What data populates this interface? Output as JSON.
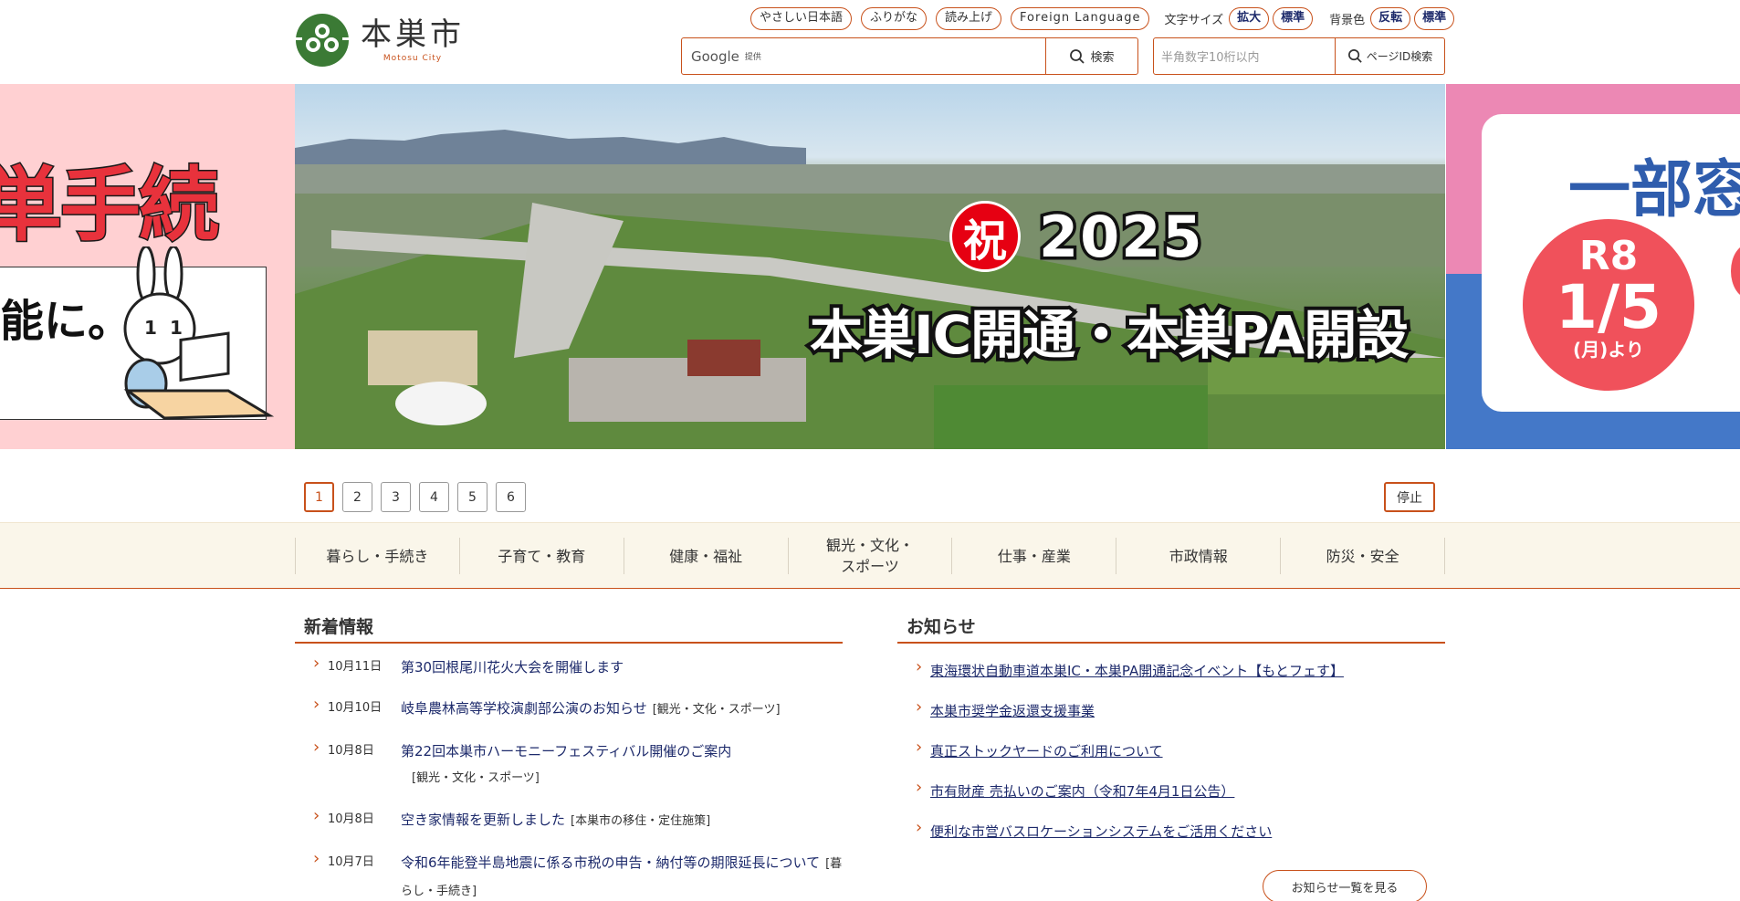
{
  "site": {
    "name": "本巣市",
    "name_romaji": "Motosu City"
  },
  "utility": {
    "easy_japanese": "やさしい日本語",
    "furigana": "ふりがな",
    "read_aloud": "読み上げ",
    "foreign_language": "Foreign Language",
    "font_size_label": "文字サイズ",
    "font_size_enlarge": "拡大",
    "font_size_standard": "標準",
    "bg_color_label": "背景色",
    "bg_invert": "反転",
    "bg_standard": "標準"
  },
  "search": {
    "provider": "Google",
    "provided_by": "提供",
    "button_label": "検索"
  },
  "page_id_search": {
    "placeholder": "半角数字10桁以内",
    "button_label": "ページID検索"
  },
  "carousel": {
    "left_slide": {
      "headline": "単手続",
      "sub": "能に。"
    },
    "main_slide": {
      "badge": "祝",
      "year": "2025",
      "caption": "本巣IC開通・本巣PA開設"
    },
    "right_slide": {
      "headline": "一部窓",
      "era": "R8",
      "date": "1/5",
      "weekday": "(月)より"
    },
    "pages": [
      "1",
      "2",
      "3",
      "4",
      "5",
      "6"
    ],
    "active_page": 1,
    "stop_label": "停止"
  },
  "global_nav": [
    {
      "label": "暮らし・手続き"
    },
    {
      "label": "子育て・教育"
    },
    {
      "label": "健康・福祉"
    },
    {
      "label": "観光・文化・\nスポーツ"
    },
    {
      "label": "仕事・産業"
    },
    {
      "label": "市政情報"
    },
    {
      "label": "防災・安全"
    }
  ],
  "news": {
    "title": "新着情報",
    "items": [
      {
        "date": "10月11日",
        "title": "第30回根尾川花火大会を開催します",
        "tag": ""
      },
      {
        "date": "10月10日",
        "title": "岐阜農林高等学校演劇部公演のお知らせ",
        "tag": "[観光・文化・スポーツ]"
      },
      {
        "date": "10月8日",
        "title": "第22回本巣市ハーモニーフェスティバル開催のご案内",
        "tag": "[観光・文化・スポーツ]"
      },
      {
        "date": "10月8日",
        "title": "空き家情報を更新しました",
        "tag": "[本巣市の移住・定住施策]"
      },
      {
        "date": "10月7日",
        "title": "令和6年能登半島地震に係る市税の申告・納付等の期限延長について",
        "tag": "[暮らし・手続き]"
      }
    ]
  },
  "notices": {
    "title": "お知らせ",
    "items": [
      {
        "title": "東海環状自動車道本巣IC・本巣PA開通記念イベント【もとフェす】"
      },
      {
        "title": "本巣市奨学金返還支援事業"
      },
      {
        "title": "真正ストックヤードのご利用について"
      },
      {
        "title": "市有財産 売払いのご案内（令和7年4月1日公告）"
      },
      {
        "title": "便利な市営バスロケーションシステムをご活用ください"
      }
    ],
    "more_label": "お知らせ一覧を見る"
  },
  "colors": {
    "accent": "#c8511b",
    "link": "#1d2a6b",
    "nav_bg": "#faf6ea",
    "logo_green": "#3b7a35"
  }
}
